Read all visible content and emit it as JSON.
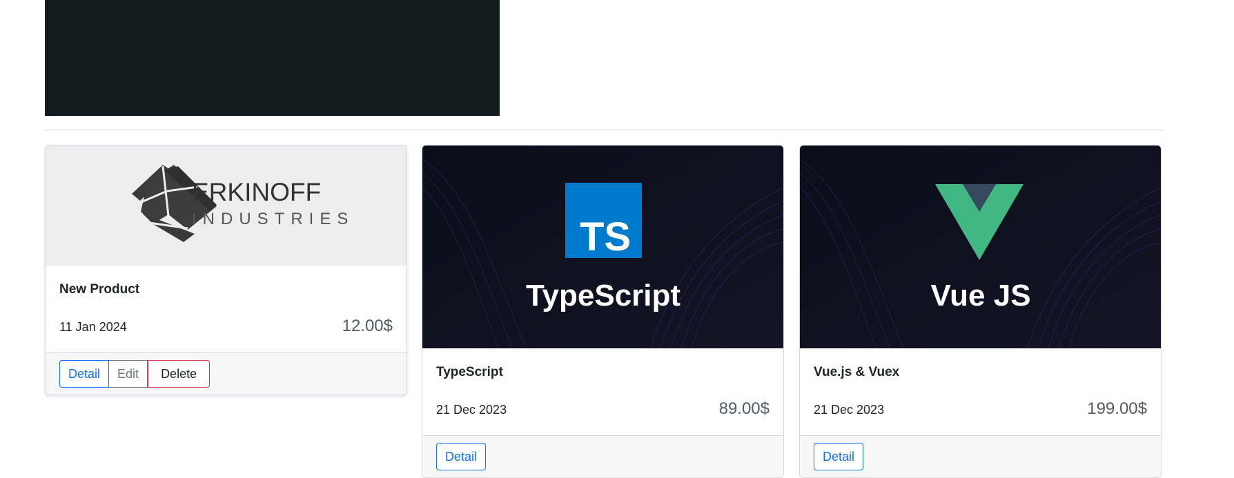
{
  "products": [
    {
      "title": "New Product",
      "date": "11 Jan 2024",
      "price": "12.00$",
      "image_logo_line1": "ERKINOFF",
      "image_logo_line2": "INDUSTRIES",
      "buttons": {
        "detail": "Detail",
        "edit": "Edit",
        "delete": "Delete"
      }
    },
    {
      "title": "TypeScript",
      "date": "21 Dec 2023",
      "price": "89.00$",
      "image_badge": "TS",
      "image_caption": "TypeScript",
      "buttons": {
        "detail": "Detail"
      }
    },
    {
      "title": "Vue.js & Vuex",
      "date": "21 Dec 2023",
      "price": "199.00$",
      "image_caption": "Vue JS",
      "buttons": {
        "detail": "Detail"
      }
    }
  ],
  "colors": {
    "banner_bg": "#131c20",
    "primary": "#0d6efd",
    "secondary": "#6c757d",
    "danger": "#dc3545",
    "ts_blue": "#007acc",
    "vue_green": "#41b883",
    "vue_dark": "#35495e"
  }
}
